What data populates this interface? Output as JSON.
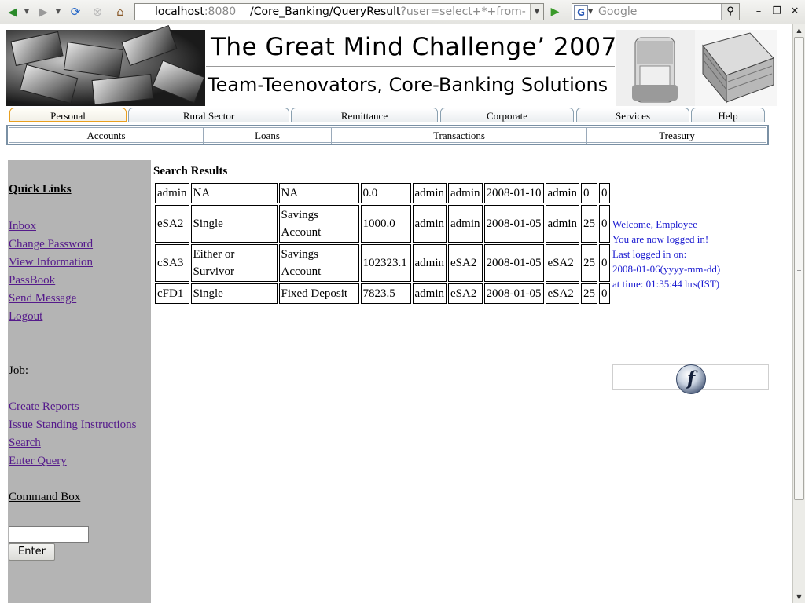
{
  "browser": {
    "url_host": "localhost",
    "url_port": ":8080",
    "url_path": "/Core_Banking/QueryResult",
    "url_query": "?user=select+*+from- ...",
    "search_placeholder": "Google",
    "icons": {
      "back": "back-arrow-icon",
      "forward": "forward-arrow-icon",
      "reload": "reload-icon",
      "stop": "stop-icon",
      "home": "home-icon",
      "go": "go-arrow-icon",
      "search": "magnifier-icon",
      "minimize": "minimize-icon",
      "restore": "restore-icon",
      "close": "close-icon"
    }
  },
  "banner": {
    "title": "The Great Mind Challenge’ 2007",
    "subtitle": "Team-Teenovators, Core-Banking Solutions"
  },
  "tabs": [
    {
      "label": "Personal",
      "active": true
    },
    {
      "label": "Rural Sector"
    },
    {
      "label": "Remittance"
    },
    {
      "label": "Corporate"
    },
    {
      "label": "Services"
    },
    {
      "label": "Help"
    }
  ],
  "subnav": [
    "Accounts",
    "Loans",
    "Transactions",
    "Treasury"
  ],
  "sidebar": {
    "quick_links_heading": "Quick Links",
    "quick_links": [
      "Inbox",
      "Change Password",
      "View Information",
      "PassBook",
      "Send Message",
      "Logout"
    ],
    "job_heading": "Job:",
    "job_links": [
      "Create Reports",
      "Issue Standing Instructions",
      "Search",
      "Enter Query"
    ],
    "command_heading": "Command Box",
    "command_value": "",
    "enter_label": "Enter"
  },
  "results": {
    "title": "Search Results",
    "rows": [
      [
        "admin",
        "NA",
        "NA",
        "0.0",
        "admin",
        "admin",
        "2008-01-10",
        "admin",
        "0",
        "0"
      ],
      [
        "eSA2",
        "Single",
        "Savings Account",
        "1000.0",
        "admin",
        "admin",
        "2008-01-05",
        "admin",
        "25",
        "0"
      ],
      [
        "cSA3",
        "Either or Survivor",
        "Savings Account",
        "102323.1",
        "admin",
        "eSA2",
        "2008-01-05",
        "eSA2",
        "25",
        "0"
      ],
      [
        "cFD1",
        "Single",
        "Fixed Deposit",
        "7823.5",
        "admin",
        "eSA2",
        "2008-01-05",
        "eSA2",
        "25",
        "0"
      ]
    ]
  },
  "welcome": {
    "line1": "Welcome, Employee",
    "line2": "You are now logged in!",
    "line3": "Last logged in on:",
    "line4": "2008-01-06(yyyy-mm-dd)",
    "line5": "at time: 01:35:44 hrs(IST)"
  },
  "colors": {
    "sidebar_bg": "#b4b4b4",
    "visited_link": "#551a8b",
    "welcome_text": "#1a1ad0",
    "active_tab": "#e8a020"
  }
}
